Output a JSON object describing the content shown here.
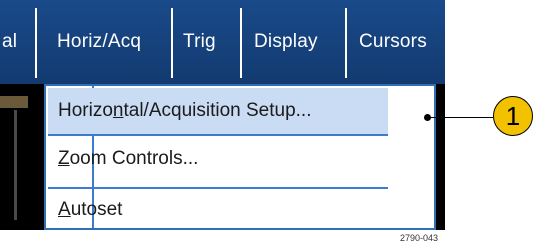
{
  "menubar": {
    "items": [
      {
        "label": "al"
      },
      {
        "label": "Horiz/Acq"
      },
      {
        "label": "Trig"
      },
      {
        "label": "Display"
      },
      {
        "label": "Cursors"
      }
    ]
  },
  "dropdown": {
    "items": [
      {
        "prefix": "Horizo",
        "mnemonic": "n",
        "suffix": "tal/Acquisition Setup..."
      },
      {
        "prefix": "",
        "mnemonic": "Z",
        "suffix": "oom Controls..."
      },
      {
        "prefix": "",
        "mnemonic": "A",
        "suffix": "utoset"
      }
    ]
  },
  "callout": {
    "label": "1",
    "color": "#f2c100"
  },
  "figure_code": "2790-043",
  "colors": {
    "menubar": "#1a4a8a",
    "highlight": "#c9dcf4",
    "border": "#2f6fb5"
  }
}
